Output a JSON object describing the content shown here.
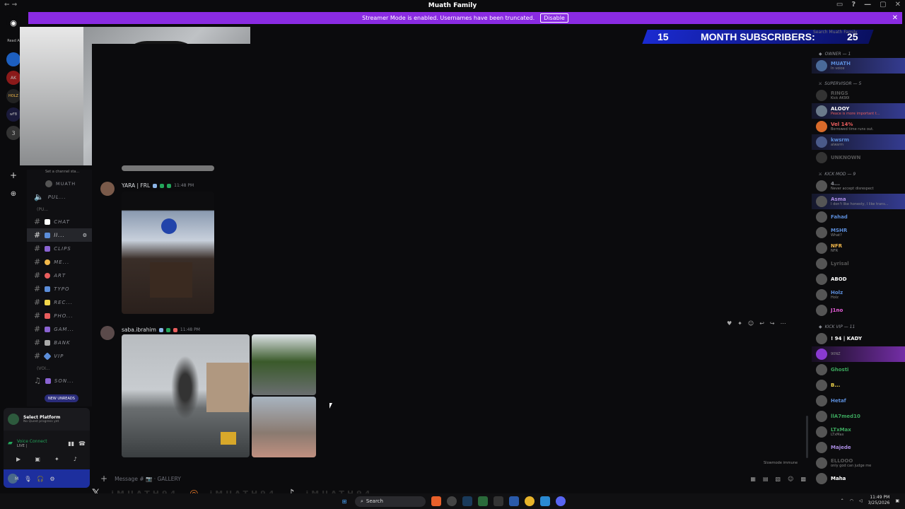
{
  "window": {
    "title": "Muath Family",
    "nav": "← →",
    "controls": [
      "▭",
      "?",
      "—",
      "▢",
      "✕"
    ]
  },
  "streamer_banner": {
    "text": "Streamer Mode is enabled. Usernames have been truncated.",
    "button": "Disable",
    "close": "✕"
  },
  "overlay": {
    "subs_count": "15",
    "subs_label": "MONTH SUBSCRIBERS:",
    "subs_goal": "25"
  },
  "servers": [
    "Read A",
    "AK",
    "HOLZ",
    "wFB",
    "3"
  ],
  "channels": {
    "topic": "Set a channel sta...",
    "voice_user": "MUATH",
    "items": [
      {
        "name": "PUL...",
        "type": "speaker",
        "active": false
      },
      {
        "name": "(PU...",
        "type": "category",
        "active": false
      },
      {
        "name": "CHAT",
        "type": "text",
        "active": false,
        "emoji": "#ffffff"
      },
      {
        "name": "ll...",
        "type": "text",
        "active": true,
        "emoji": "#5b8dd9"
      },
      {
        "name": "CLIPS",
        "type": "text",
        "active": false,
        "emoji": "#8a63d2"
      },
      {
        "name": "ME...",
        "type": "text",
        "active": false,
        "emoji": "#f2b84b"
      },
      {
        "name": "ART",
        "type": "text",
        "active": false,
        "emoji": "#e85d5d"
      },
      {
        "name": "TYPO",
        "type": "text",
        "active": false,
        "emoji": "#5b8dd9"
      },
      {
        "name": "REC...",
        "type": "text",
        "active": false,
        "emoji": "#f2d64b"
      },
      {
        "name": "PHO...",
        "type": "text",
        "active": false,
        "emoji": "#e85d5d"
      },
      {
        "name": "GAM...",
        "type": "text",
        "active": false,
        "emoji": "#8a63d2"
      },
      {
        "name": "BANK",
        "type": "text",
        "active": false,
        "emoji": "#aaaaaa"
      },
      {
        "name": "VIP",
        "type": "text",
        "active": false,
        "emoji": "#5b8dd9"
      },
      {
        "name": "(VOI...",
        "type": "category",
        "active": false
      },
      {
        "name": "SON...",
        "type": "music",
        "active": false,
        "emoji": "#8a63d2"
      }
    ],
    "new_unreads": "NEW UNREADS"
  },
  "user_panel": {
    "quest_title": "Select Platform",
    "quest_sub": "No Quest progress yet",
    "voice_title": "Voice Connect",
    "voice_sub": "LIVE |",
    "user_initial": "M"
  },
  "messages": [
    {
      "author": "YARA | FRL",
      "time": "11:48 PM",
      "author_color": "#dbdee1"
    },
    {
      "author": "saba.ibrahim",
      "time": "11:48 PM",
      "author_color": "#dbdee1"
    }
  ],
  "composer": {
    "placeholder": "Message # 📷 · GALLERY",
    "plus": "+"
  },
  "slowmode": "Slowmode immune",
  "members": {
    "search": "Search Muath Family",
    "roles": [
      {
        "name": "OWNER — 1",
        "members": [
          {
            "name": "MUATH",
            "status": "In voice",
            "color": "#5b8dd9",
            "banner": "blue"
          }
        ]
      },
      {
        "name": "SUPERVISOR — 5",
        "members": [
          {
            "name": "RINGS",
            "status": "Kick AK90l",
            "color": "#555555",
            "banner": ""
          },
          {
            "name": "ALOOY",
            "status": "Peace is more important t...",
            "color": "#ffffff",
            "banner": "blue"
          },
          {
            "name": "Vel 14%",
            "status": "Borrowed time runs out.",
            "color": "#e85d5d",
            "banner": ""
          },
          {
            "name": "kwsrm",
            "status": "alwsrm",
            "color": "#5b8dd9",
            "banner": "blue"
          },
          {
            "name": "UNKNOWN",
            "status": "",
            "color": "#555555",
            "banner": ""
          }
        ]
      },
      {
        "name": "KICK MOD — 9",
        "members": [
          {
            "name": "4...",
            "status": "Never accept disrespect",
            "color": "#8b8d94",
            "banner": ""
          },
          {
            "name": "Asma",
            "status": "I don't like honesty, I like trans...",
            "color": "#a98be0",
            "banner": "blue"
          },
          {
            "name": "Fahad",
            "status": "",
            "color": "#5b8dd9",
            "banner": ""
          },
          {
            "name": "MSHR",
            "status": "What?",
            "color": "#5b8dd9",
            "banner": ""
          },
          {
            "name": "NFR",
            "status": "NFR",
            "color": "#f2b84b",
            "banner": ""
          },
          {
            "name": "Lyrisal",
            "status": "",
            "color": "#555555",
            "banner": ""
          },
          {
            "name": "ABOD",
            "status": "",
            "color": "#ffffff",
            "banner": ""
          },
          {
            "name": "Holz",
            "status": "Holz",
            "color": "#5b8dd9",
            "banner": ""
          },
          {
            "name": "J1no",
            "status": "",
            "color": "#e85dd9",
            "banner": ""
          }
        ]
      },
      {
        "name": "KICK VIP — 11",
        "members": [
          {
            "name": "! 94 | KADY",
            "status": "",
            "color": "#ffffff",
            "banner": ""
          },
          {
            "name": "",
            "status": "90NZ",
            "color": "#a98be0",
            "banner": "purple"
          },
          {
            "name": "Ghosti",
            "status": "",
            "color": "#3ba55c",
            "banner": ""
          },
          {
            "name": "B...",
            "status": "",
            "color": "#f2d64b",
            "banner": ""
          },
          {
            "name": "Hetaf",
            "status": "",
            "color": "#5b8dd9",
            "banner": ""
          },
          {
            "name": "llA7med10",
            "status": "",
            "color": "#3ba55c",
            "banner": ""
          },
          {
            "name": "LTxMax",
            "status": "LTxMax",
            "color": "#3ba55c",
            "banner": ""
          },
          {
            "name": "Majede",
            "status": "",
            "color": "#a98be0",
            "banner": ""
          },
          {
            "name": "ELLOOO",
            "status": "only god can judge me",
            "color": "#555555",
            "banner": ""
          },
          {
            "name": "Maha",
            "status": "",
            "color": "#ffffff",
            "banner": ""
          }
        ]
      }
    ]
  },
  "stream_overlay": {
    "handle1": "iMUATH94",
    "handle2": "iMUATH94",
    "handle3": "iMUATH94"
  },
  "taskbar": {
    "search": "Search",
    "time": "11:49 PM",
    "date": "3/25/2026"
  }
}
